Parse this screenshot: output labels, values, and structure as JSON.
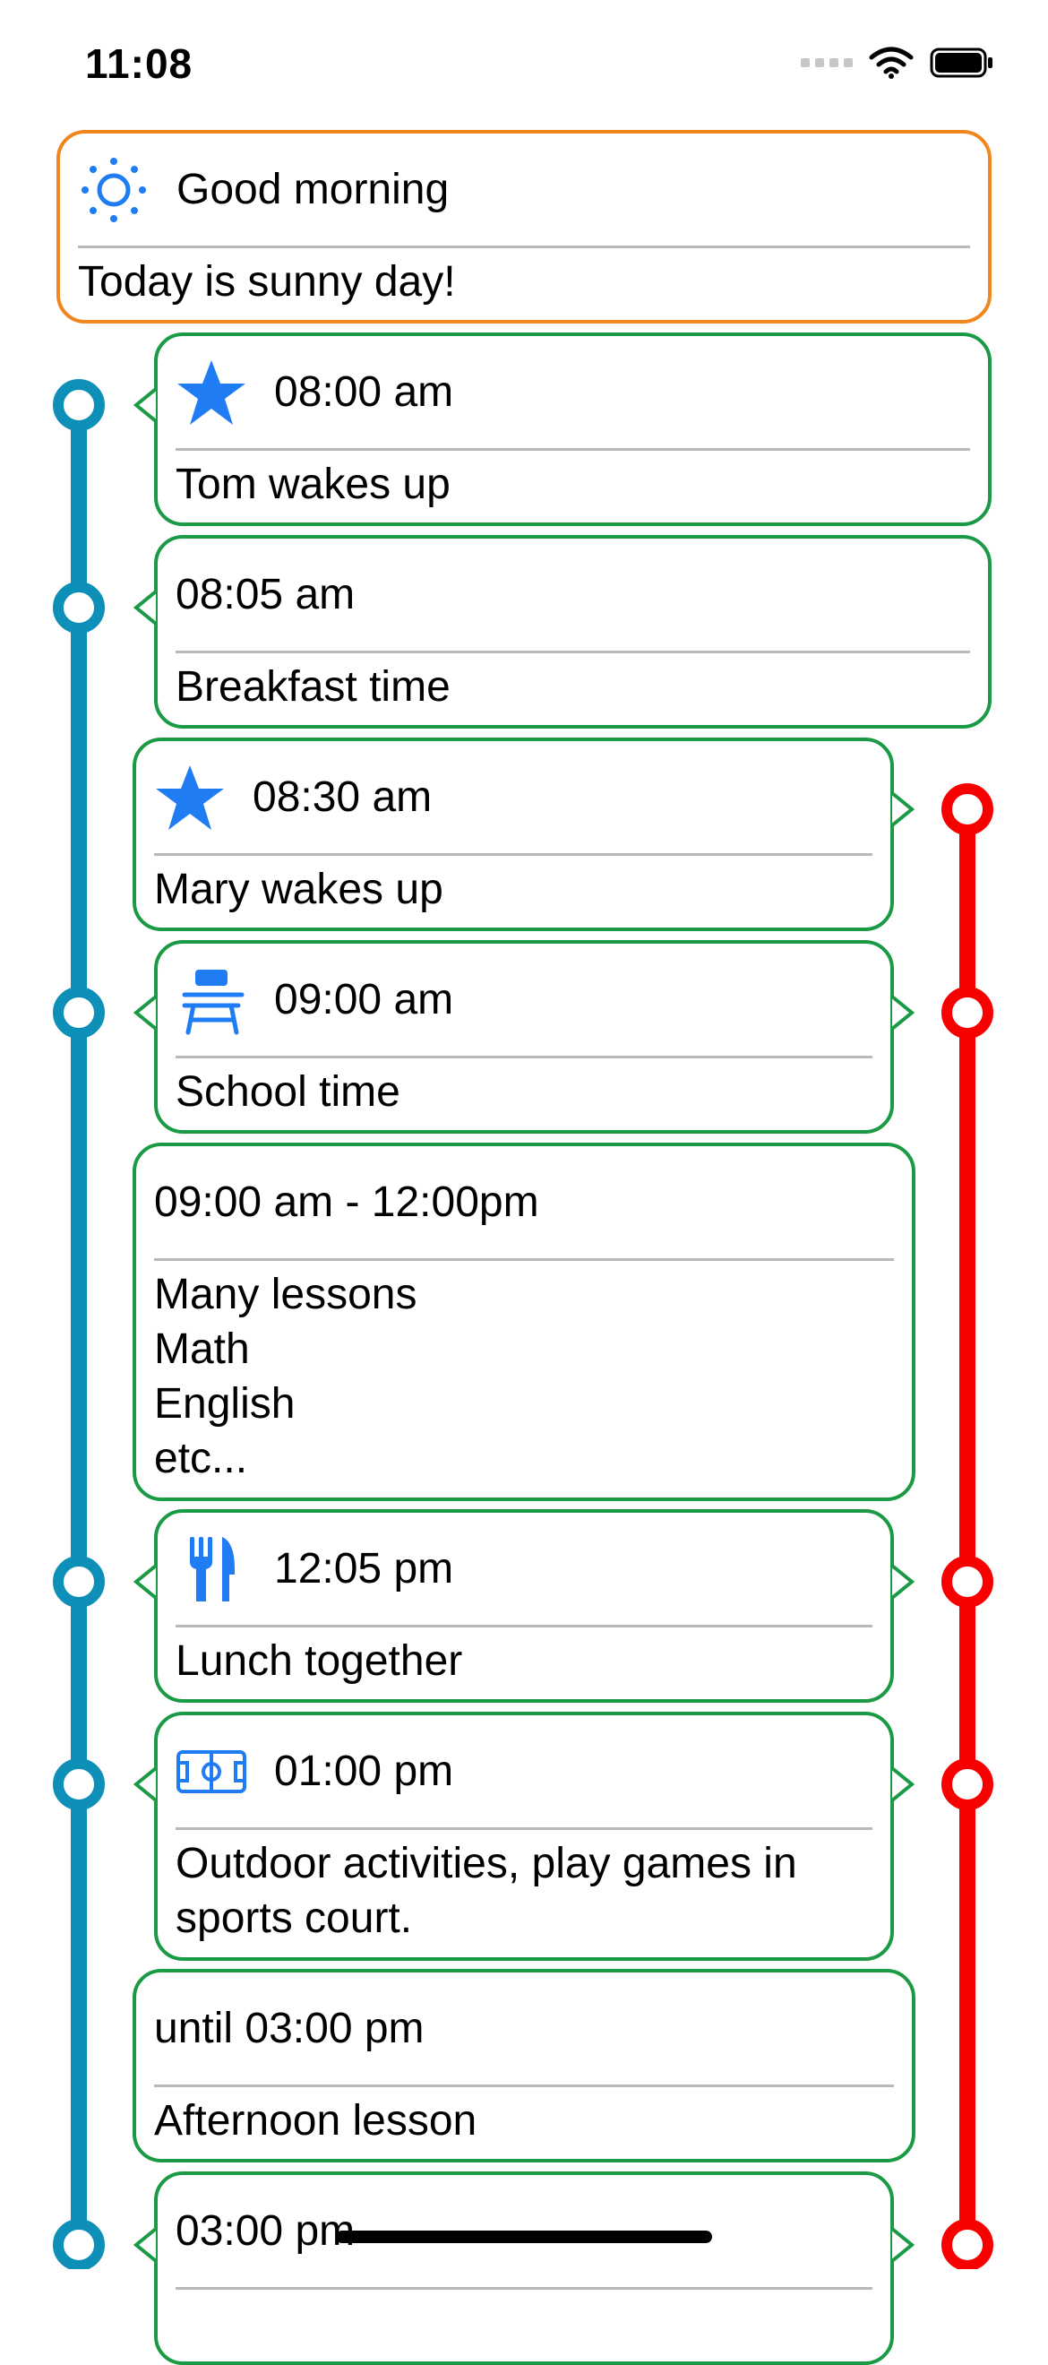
{
  "status_bar": {
    "time": "11:08"
  },
  "colors": {
    "left_track": "#0e8fb7",
    "right_track": "#f80000",
    "card_border": "#1a9a44",
    "greeting_border": "#f0861e",
    "icon_blue": "#1f7cf2"
  },
  "greeting": {
    "title": "Good morning",
    "body": "Today is sunny day!",
    "icon": "sun-icon"
  },
  "events": [
    {
      "title": "08:00 am",
      "body": "Tom wakes up",
      "icon": "star-icon"
    },
    {
      "title": "08:05 am",
      "body": "Breakfast time",
      "icon": ""
    },
    {
      "title": "08:30 am",
      "body": "Mary wakes up",
      "icon": "star-icon"
    },
    {
      "title": "09:00 am",
      "body": "School time",
      "icon": "school-desk-icon"
    },
    {
      "title": "09:00 am - 12:00pm",
      "body": "Many lessons\nMath\nEnglish\netc...",
      "icon": ""
    },
    {
      "title": "12:05 pm",
      "body": "Lunch together",
      "icon": "fork-knife-icon"
    },
    {
      "title": "01:00 pm",
      "body": "Outdoor activities, play games in\nsports court.",
      "icon": "sports-court-icon"
    },
    {
      "title": "until 03:00 pm",
      "body": "Afternoon lesson",
      "icon": ""
    },
    {
      "title": "03:00 pm",
      "body": "",
      "icon": ""
    }
  ]
}
